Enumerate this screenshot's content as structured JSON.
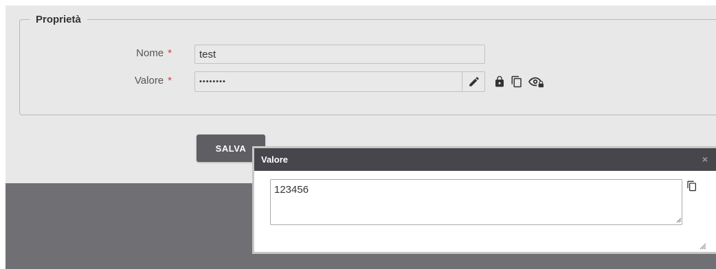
{
  "properties": {
    "legend": "Proprietà",
    "name": {
      "label": "Nome",
      "required": "*",
      "value": "test"
    },
    "value": {
      "label": "Valore",
      "required": "*",
      "masked_value": "••••••••"
    }
  },
  "actions": {
    "save_label": "SALVA"
  },
  "dialog": {
    "title": "Valore",
    "close": "×",
    "text": "123456"
  },
  "icons": {
    "edit": "pencil-icon",
    "lock": "lock-icon",
    "copy": "copy-icon",
    "reveal": "eye-lock-icon"
  }
}
